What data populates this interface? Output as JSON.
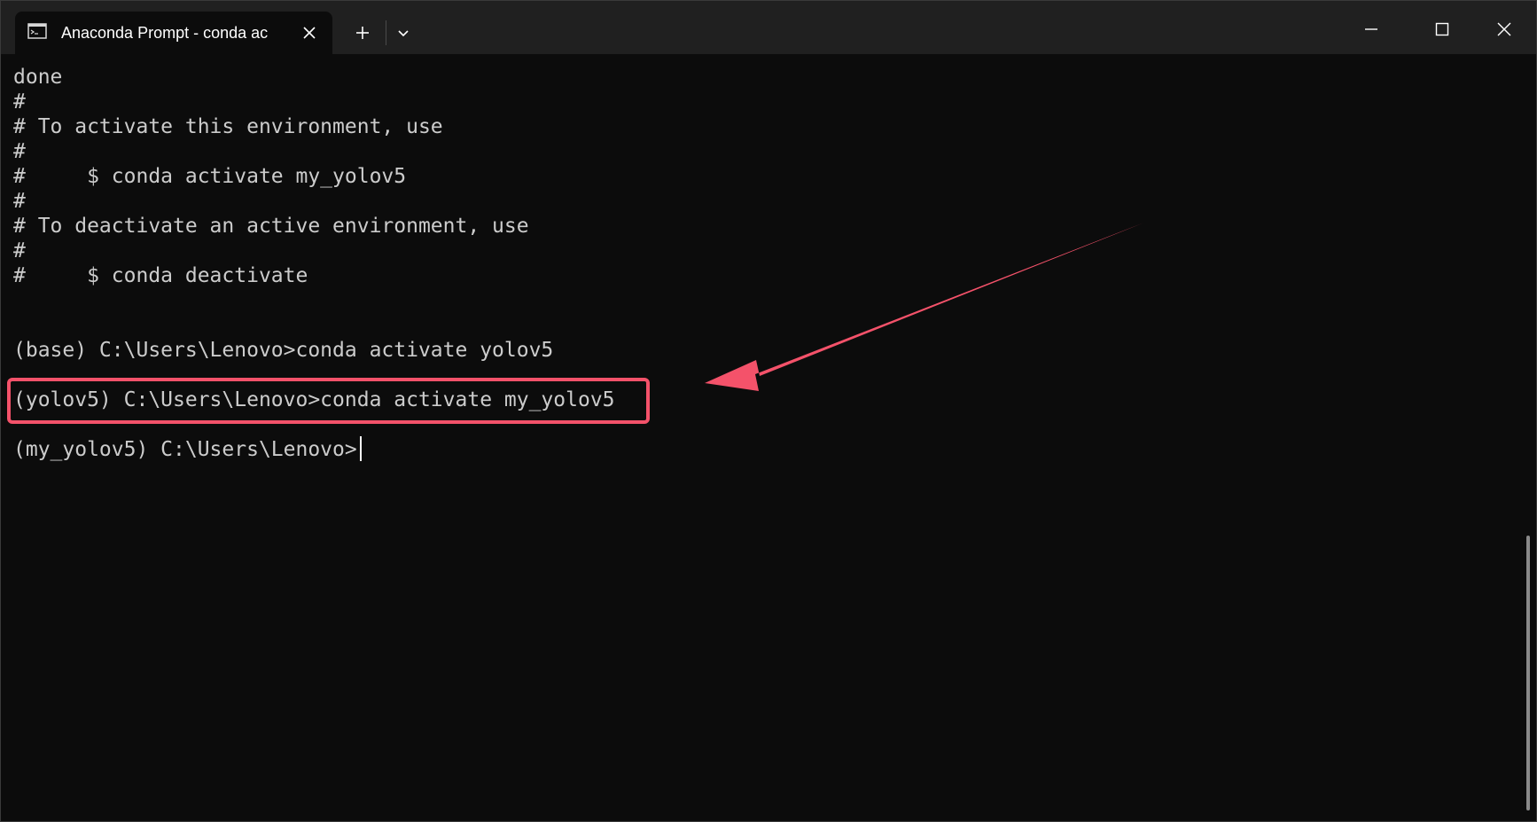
{
  "window": {
    "tab_title": "Anaconda Prompt - conda  ac",
    "icons": {
      "tab": "terminal-icon",
      "tab_close": "close-icon",
      "new_tab": "plus-icon",
      "dropdown": "chevron-down-icon",
      "minimize": "minimize-icon",
      "maximize": "maximize-icon",
      "close": "close-icon"
    }
  },
  "terminal": {
    "lines": [
      "done",
      "#",
      "# To activate this environment, use",
      "#",
      "#     $ conda activate my_yolov5",
      "#",
      "# To deactivate an active environment, use",
      "#",
      "#     $ conda deactivate",
      "",
      "",
      "(base) C:\\Users\\Lenovo>conda activate yolov5",
      "",
      "(yolov5) C:\\Users\\Lenovo>conda activate my_yolov5",
      "",
      "(my_yolov5) C:\\Users\\Lenovo>"
    ]
  },
  "annotation": {
    "color": "#f4526a"
  },
  "colors": {
    "background": "#0c0c0c",
    "titlebar": "#202020",
    "text": "#cccccc",
    "accent": "#f4526a"
  }
}
